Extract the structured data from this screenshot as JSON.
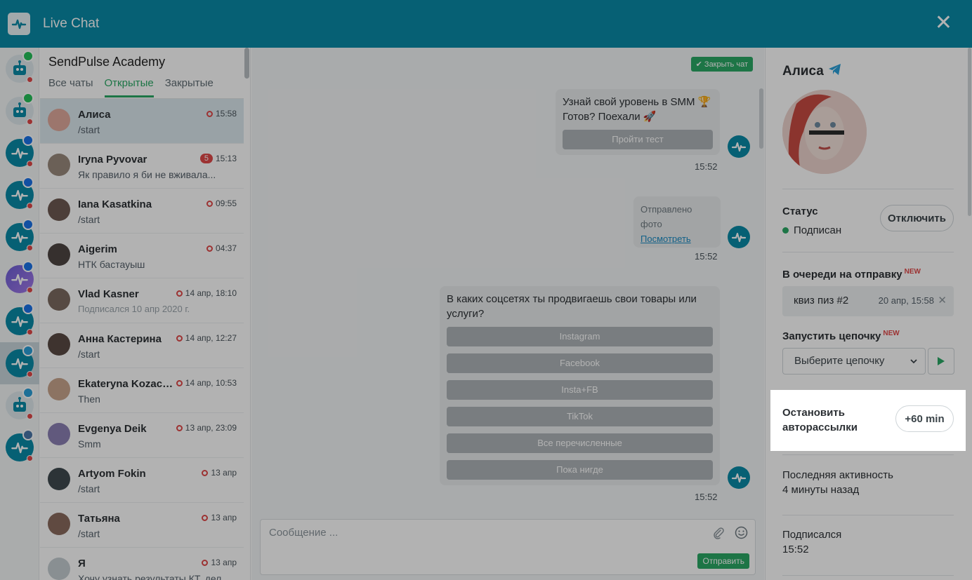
{
  "app": {
    "title": "Live Chat",
    "close_symbol": "✕"
  },
  "chatlist": {
    "project": "SendPulse Academy",
    "tabs": [
      {
        "label": "Все чаты",
        "active": false
      },
      {
        "label": "Открытые",
        "active": true
      },
      {
        "label": "Закрытые",
        "active": false
      }
    ],
    "rows": [
      {
        "name": "Алиса",
        "preview": "/start",
        "time": "15:58",
        "unread": "",
        "active": true,
        "avatar_color": "#e0a99c"
      },
      {
        "name": "Iryna Pyvovar",
        "preview": "Як правило я би не вживала...",
        "time": "15:13",
        "unread": "5",
        "active": false,
        "avatar_color": "#9a8a7d"
      },
      {
        "name": "Iana Kasatkina",
        "preview": "/start",
        "time": "09:55",
        "unread": "",
        "active": false,
        "avatar_color": "#6d5a52"
      },
      {
        "name": "Aigerim",
        "preview": "НТК бастауыш",
        "time": "04:37",
        "unread": "",
        "active": false,
        "avatar_color": "#4e4542"
      },
      {
        "name": "Vlad Kasner",
        "preview": "Подписался 10 апр 2020 г.",
        "preview_muted": true,
        "time": "14 апр, 18:10",
        "unread": "",
        "active": false,
        "avatar_color": "#7c6b60"
      },
      {
        "name": "Анна Кастерина",
        "preview": "/start",
        "time": "14 апр, 12:27",
        "unread": "",
        "active": false,
        "avatar_color": "#5a4a44"
      },
      {
        "name": "Ekateryna Kozachenko",
        "preview": "Then",
        "time": "14 апр, 10:53",
        "unread": "",
        "active": false,
        "avatar_color": "#c9a58d"
      },
      {
        "name": "Evgenya Deik",
        "preview": "Smm",
        "time": "13 апр, 23:09",
        "unread": "",
        "active": false,
        "avatar_color": "#8b80b3"
      },
      {
        "name": "Artyom Fokin",
        "preview": "/start",
        "time": "13 апр",
        "unread": "",
        "active": false,
        "avatar_color": "#3f4a4f"
      },
      {
        "name": "Татьяна",
        "preview": "/start",
        "time": "13 апр",
        "unread": "",
        "active": false,
        "avatar_color": "#8a6a5d"
      },
      {
        "name": "Я",
        "preview": "Хочу узнать результаты КТ, делала...",
        "time": "13 апр",
        "unread": "",
        "active": false,
        "avatar_color": "#c5cdd2"
      }
    ]
  },
  "bots": [
    {
      "type": "robot",
      "channel": "whatsapp",
      "channel_color": "#25c05a"
    },
    {
      "type": "robot",
      "channel": "whatsapp",
      "channel_color": "#25c05a"
    },
    {
      "type": "pulse",
      "channel": "messenger",
      "channel_color": "#1b73e8"
    },
    {
      "type": "pulse",
      "channel": "messenger",
      "channel_color": "#1b73e8"
    },
    {
      "type": "pulse",
      "channel": "messenger",
      "channel_color": "#1b73e8"
    },
    {
      "type": "purple",
      "channel": "messenger",
      "channel_color": "#1b73e8"
    },
    {
      "type": "pulse",
      "channel": "messenger",
      "channel_color": "#1b73e8"
    },
    {
      "type": "pulse",
      "channel": "telegram",
      "channel_color": "#2a9fd8",
      "active": true
    },
    {
      "type": "robot",
      "channel": "telegram",
      "channel_color": "#2a9fd8"
    },
    {
      "type": "pulse",
      "channel": "vk",
      "channel_color": "#4a76a8"
    }
  ],
  "conversation": {
    "close_chat": "Закрыть чат",
    "msg1": {
      "line1": "Узнай свой уровень в SMM 🏆",
      "line2": "Готов? Поехали 🚀",
      "button": "Пройти тест",
      "time": "15:52"
    },
    "msg2": {
      "text": "Отправлено фото",
      "link": "Посмотреть",
      "time": "15:52"
    },
    "msg3": {
      "text": "В каких соцсетях ты продвигаешь свои товары или услуги?",
      "buttons": [
        "Instagram",
        "Facebook",
        "Insta+FB",
        "TikTok",
        "Все перечисленные",
        "Пока нигде"
      ],
      "time": "15:52"
    },
    "composer": {
      "placeholder": "Сообщение ...",
      "send": "Отправить"
    }
  },
  "panel": {
    "name": "Алиса",
    "status_label": "Статус",
    "status_value": "Подписан",
    "unsubscribe": "Отключить",
    "queue_label": "В очереди на отправку",
    "new_badge": "NEW",
    "queue_item": {
      "name": "квиз пиз #2",
      "date": "20 апр, 15:58"
    },
    "chain_label": "Запустить цепочку",
    "chain_select": "Выберите цепочку",
    "stop_label": "Остановить авторассылки",
    "stop_button": "+60 min",
    "last_activity_label": "Последняя активность",
    "last_activity_value": "4 минуты назад",
    "subscribed_label": "Подписался",
    "subscribed_value": "15:52"
  }
}
